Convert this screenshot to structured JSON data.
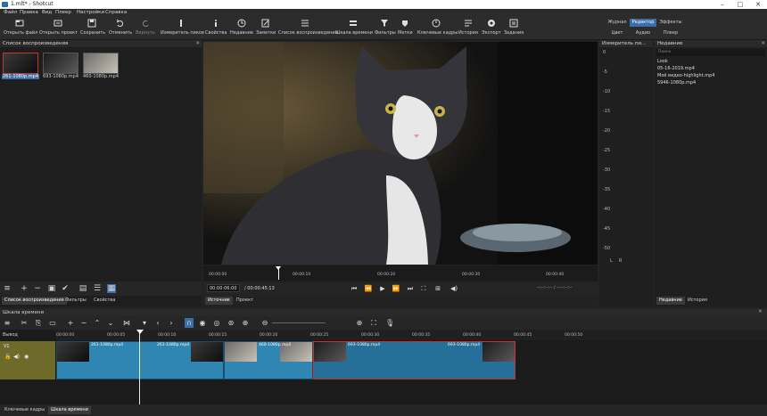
{
  "window": {
    "title": "1.mlt* - Shotcut",
    "controls": [
      "–",
      "□",
      "✕"
    ]
  },
  "menu": [
    "Файл",
    "Правка",
    "Вид",
    "Плеер",
    "Настройки",
    "Справка"
  ],
  "toolbar": [
    {
      "label": "Открыть файл",
      "icon": "open-file-icon"
    },
    {
      "label": "Открыть проект",
      "icon": "open-project-icon"
    },
    {
      "label": "Сохранить",
      "icon": "save-icon"
    },
    {
      "label": "Отменить",
      "icon": "undo-icon"
    },
    {
      "label": "Вернуть",
      "icon": "redo-icon"
    },
    {
      "label": "Измеритель пиков",
      "icon": "peak-meter-icon"
    },
    {
      "label": "Свойства",
      "icon": "properties-icon"
    },
    {
      "label": "Недавние",
      "icon": "recent-icon"
    },
    {
      "label": "Заметки",
      "icon": "notes-icon"
    },
    {
      "label": "Список воспроизведения",
      "icon": "playlist-icon"
    },
    {
      "label": "Шкала времени",
      "icon": "timeline-icon"
    },
    {
      "label": "Фильтры",
      "icon": "filter-icon"
    },
    {
      "label": "Метки",
      "icon": "markers-icon"
    },
    {
      "label": "Ключевые кадры",
      "icon": "keyframes-icon"
    },
    {
      "label": "История",
      "icon": "history-icon"
    },
    {
      "label": "Экспорт",
      "icon": "export-icon"
    },
    {
      "label": "Задания",
      "icon": "jobs-icon"
    }
  ],
  "layouts": {
    "row1": [
      "Журнал",
      "Редактор",
      "Эффекты"
    ],
    "row2": [
      "Цвет",
      "Аудио",
      "Плеер"
    ],
    "active": "Редактор"
  },
  "playlist": {
    "title": "Список воспроизведения",
    "items": [
      "261-1080p.mp4",
      "693-1080p.mp4",
      "460-1080p.mp4"
    ],
    "tabs": [
      "Список воспроизведения",
      "Фильтры",
      "Свойства"
    ]
  },
  "viewer": {
    "ruler_marks": [
      "00:00:00",
      "00:00:10",
      "00:00:20",
      "00:00:30",
      "00:00:40"
    ],
    "current_time": "00:00:06:00",
    "duration": "/ 00:00:45:13",
    "in_out": "--:--:--:-- / --:--:--:--",
    "tabs": [
      "Источник",
      "Проект"
    ]
  },
  "meter": {
    "title": "Измеритель пи...",
    "scale": [
      "0",
      "-5",
      "-10",
      "-15",
      "-20",
      "-25",
      "-30",
      "-35",
      "-40",
      "-45",
      "-50",
      "L",
      "R"
    ]
  },
  "recent": {
    "title": "Недавние",
    "search_placeholder": "Поиск",
    "items": [
      "Look",
      "05-16-2019.mp4",
      "Моё видео-highlight.mp4",
      "5946-1080p.mp4"
    ],
    "tabs": [
      "Недавние",
      "История"
    ]
  },
  "timeline": {
    "title": "Шкала времени",
    "output_label": "Вывод",
    "track": "V1",
    "ticks": [
      "00:00:00",
      "00:00:05",
      "00:00:10",
      "00:00:15",
      "00:00:20",
      "00:00:25",
      "00:00:30",
      "00:00:35",
      "00:00:40",
      "00:00:45",
      "00:00:50"
    ],
    "clips": [
      "261-1080p.mp4",
      "261-1080p.mp4",
      "460-1080p.mp4",
      "693-1080p.mp4",
      "693-1080p.mp4"
    ]
  },
  "bottom_tabs": [
    "Ключевые кадры",
    "Шкала времени"
  ],
  "colors": {
    "accent": "#3b6ea8",
    "clip": "#2f86b3",
    "track_head": "#6d6a2a",
    "selection": "#c8352b"
  }
}
